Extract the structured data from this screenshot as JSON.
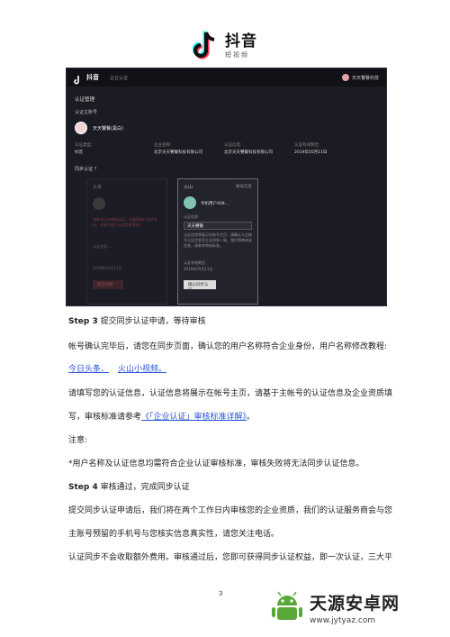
{
  "logo": {
    "name": "抖音",
    "sub": "短视频"
  },
  "screenshot": {
    "brand": "抖音",
    "brand_sub": "企业认证",
    "user_name": "天天饕餮科技",
    "section_title": "认证管理",
    "subaccount_label": "认证主账号",
    "account_name": "天天饕餮(黑白)",
    "info": [
      {
        "label": "认证类型:",
        "value": "抖音"
      },
      {
        "label": "企业名称:",
        "value": "北京天天饕餮科技有限公司"
      },
      {
        "label": "认证信息:",
        "value": "北京天天饕餮科技有限公司"
      },
      {
        "label": "认证有效期至:",
        "value": "2019年05月11日"
      }
    ],
    "sync_label": "同步认证 ?",
    "left_card": {
      "head": "头条",
      "red_text": "该账号已在审核认证，不能再进行同步认证。对账号进行认证信息更新。",
      "lines": [
        "认证信息...",
        "2019年05月11日"
      ],
      "button": "提交同步"
    },
    "right_card": {
      "head": "火山",
      "side": "帐号信息",
      "account": "手机用户408...",
      "field_label": "认证信息:",
      "field_value": "天天饕餮",
      "lines": [
        "认证信息将展示在帐号主页，请确认与主帐号认证信息及企业资质一致，我们将审核该信息。请参考审核标准。",
        "认证有效期至:",
        "2019年05月11日"
      ],
      "button": "确认同步认证"
    }
  },
  "doc": {
    "step3_label": "Step 3",
    "step3_text": "提交同步认证申请，等待审核",
    "p1": "帐号确认完毕后，请您在同步页面，确认您的用户名称符合企业身份，用户名称修改教程:",
    "link1": "今日头条、",
    "link2": "火山小视频。",
    "p2a": "请填写您的认证信息，认证信息将展示在帐号主页，请基于主帐号的认证信息及企业资质填",
    "p2b_prefix": "写，审核标准请参考",
    "link3": "《「企业认证」审核标准详解》",
    "p2b_suffix": "。",
    "note_label": "注意:",
    "note_text": "*用户名称及认证信息均需符合企业认证审核标准，审核失败将无法同步认证信息。",
    "step4_label": "Step 4",
    "step4_text": "审核通过，完成同步认证",
    "p3a": "提交同步认证申请后，我们将在两个工作日内审核您的企业资质，我们的认证服务商会与您",
    "p3b": "主账号预留的手机号与您核实信息真实性，请您关注电话。",
    "p4": "认证同步不会收取额外费用。审核通过后，您即可获得同步认证权益，即一次认证，三大平",
    "page_number": "3"
  },
  "watermark": {
    "title": "天源安卓网",
    "url": "www.jytyaz.com"
  },
  "colors": {
    "link": "#2b55d8",
    "screenshot_bg": "#1a1b23",
    "alert_red": "#e0525c"
  }
}
